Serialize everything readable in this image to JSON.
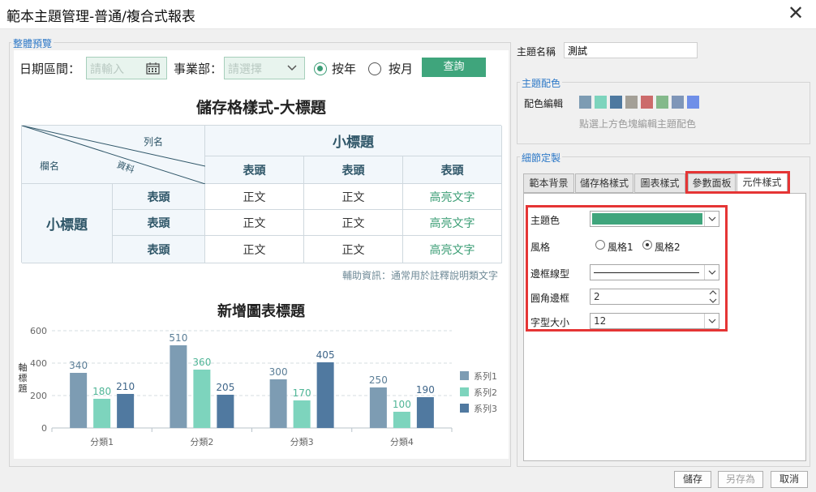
{
  "window": {
    "title": "範本主題管理-普通/複合式報表",
    "close_glyph": "✕"
  },
  "preview": {
    "legend": "整體預覽",
    "filter": {
      "date_label": "日期區間：",
      "date_placeholder": "請輸入",
      "dept_label": "事業部：",
      "dept_placeholder": "請選擇",
      "radio_year": "按年",
      "radio_month": "按月",
      "radio_selected": "按年",
      "query_button": "查詢"
    },
    "table": {
      "title": "儲存格樣式-大標題",
      "corner_col": "列名",
      "corner_data": "資料",
      "corner_row": "欄名",
      "small_title": "小標題",
      "header": "表頭",
      "body_text": "正文",
      "highlight_text": "高亮文字",
      "note": "輔助資訊：通常用於註釋說明類文字"
    }
  },
  "chart_data": {
    "type": "bar",
    "title": "新增圖表標題",
    "ylabel": "軸標題",
    "categories": [
      "分類1",
      "分類2",
      "分類3",
      "分類4"
    ],
    "ylim": [
      0,
      600
    ],
    "yticks": [
      0,
      200,
      400,
      600
    ],
    "series": [
      {
        "name": "系列1",
        "values": [
          340,
          510,
          300,
          250
        ],
        "color": "#7d9cb3",
        "label_color": "#5a7d96"
      },
      {
        "name": "系列2",
        "values": [
          180,
          360,
          170,
          100
        ],
        "color": "#7dd4bd",
        "label_color": "#4fb596"
      },
      {
        "name": "系列3",
        "values": [
          210,
          205,
          405,
          190
        ],
        "color": "#5079a0",
        "label_color": "#3e6589"
      }
    ],
    "legend_position": "right",
    "grid": true
  },
  "right": {
    "theme_name_label": "主題名稱",
    "theme_name_value": "測試",
    "color_group_legend": "主題配色",
    "color_edit_label": "配色編輯",
    "color_hint": "點選上方色塊編輯主題配色",
    "palette": [
      "#7d9cb3",
      "#7dd4bd",
      "#4e79a0",
      "#a4a097",
      "#cc6b6b",
      "#84b98b",
      "#7f96b8",
      "#6f8fe8"
    ],
    "detail_legend": "細節定製",
    "tabs": [
      "範本背景",
      "儲存格樣式",
      "圖表樣式",
      "參數面板",
      "元件樣式"
    ],
    "active_tab": "元件樣式",
    "form": {
      "theme_color_label": "主題色",
      "theme_color_value": "#3fa57c",
      "style_label": "風格",
      "style_opt1": "風格1",
      "style_opt2": "風格2",
      "style_selected": "風格2",
      "border_type_label": "邊框線型",
      "radius_label": "圓角邊框",
      "radius_value": "2",
      "font_size_label": "字型大小",
      "font_size_value": "12"
    }
  },
  "footer": {
    "save": "儲存",
    "save_as": "另存為",
    "cancel": "取消"
  }
}
